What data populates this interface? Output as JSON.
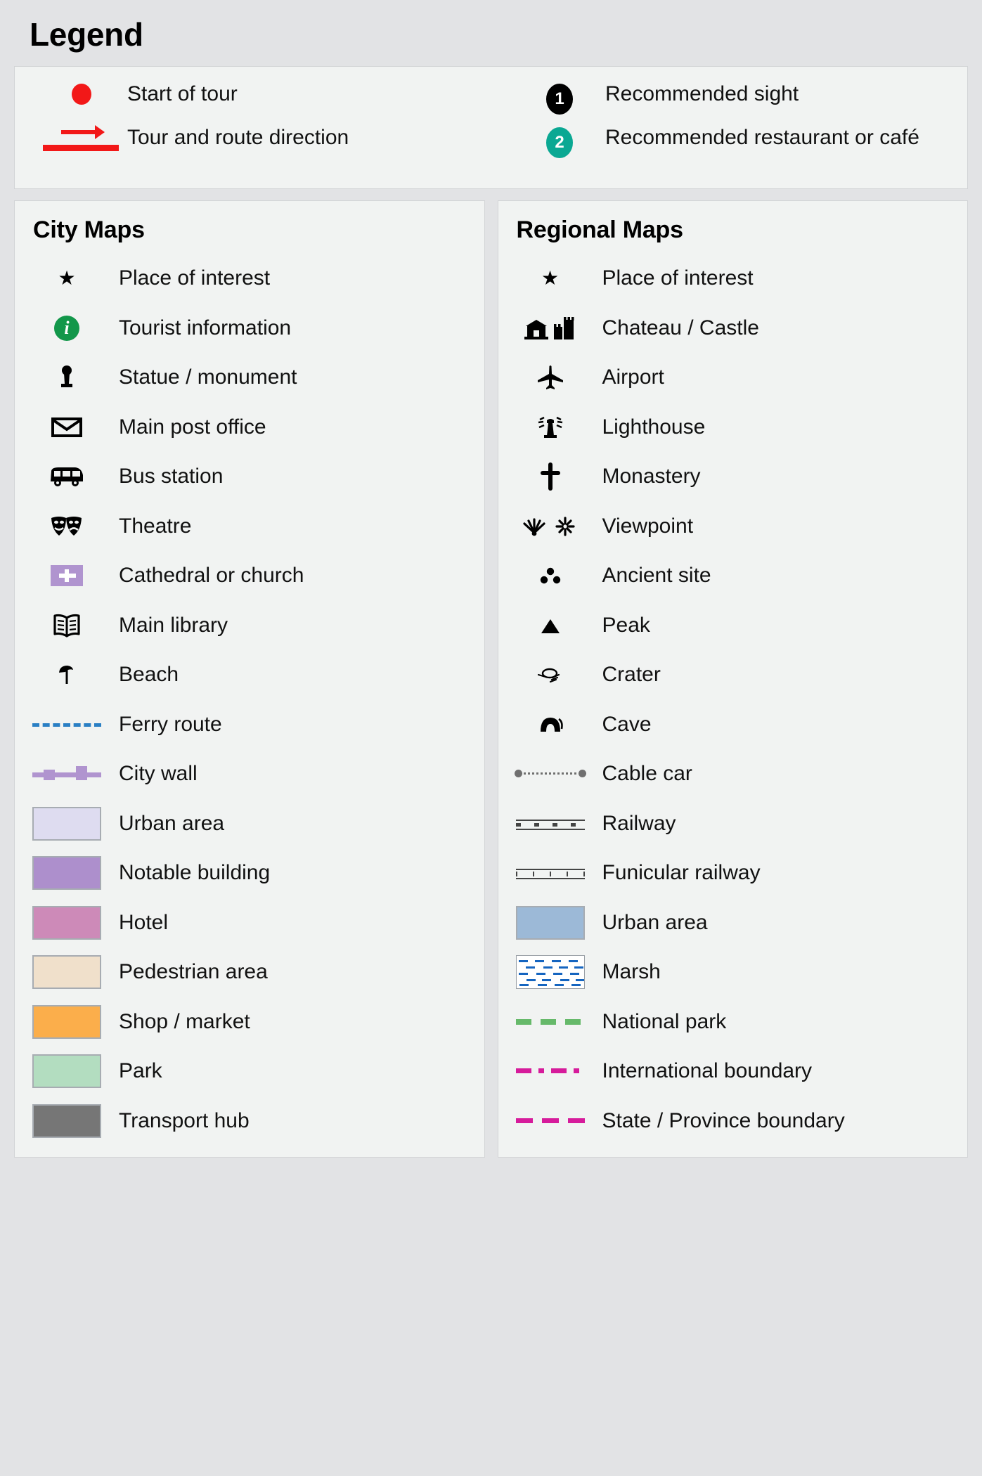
{
  "title": "Legend",
  "top": {
    "left_items": [
      {
        "label": "Start of tour",
        "symbol": "red-dot"
      },
      {
        "label": "Tour and route direction",
        "symbol": "red-arrow"
      }
    ],
    "right_items": [
      {
        "label": "Recommended sight",
        "symbol": "numbered-badge-black",
        "number": "1"
      },
      {
        "label": "Recommended restaurant or café",
        "symbol": "numbered-badge-teal",
        "number": "2"
      }
    ]
  },
  "city_maps": {
    "heading": "City Maps",
    "items": [
      {
        "label": "Place of interest",
        "symbol": "star-icon"
      },
      {
        "label": "Tourist information",
        "symbol": "information-icon"
      },
      {
        "label": "Statue / monument",
        "symbol": "statue-icon"
      },
      {
        "label": "Main post office",
        "symbol": "envelope-icon"
      },
      {
        "label": "Bus station",
        "symbol": "bus-icon"
      },
      {
        "label": "Theatre",
        "symbol": "theatre-masks-icon"
      },
      {
        "label": "Cathedral or church",
        "symbol": "church-chip-icon"
      },
      {
        "label": "Main library",
        "symbol": "open-book-icon"
      },
      {
        "label": "Beach",
        "symbol": "parasol-icon"
      },
      {
        "label": "Ferry route",
        "symbol": "ferry-dashed-line"
      },
      {
        "label": "City wall",
        "symbol": "city-wall-line"
      },
      {
        "label": "Urban area",
        "symbol": "area-swatch"
      },
      {
        "label": "Notable building",
        "symbol": "area-swatch"
      },
      {
        "label": "Hotel",
        "symbol": "area-swatch"
      },
      {
        "label": "Pedestrian area",
        "symbol": "area-swatch"
      },
      {
        "label": "Shop / market",
        "symbol": "area-swatch"
      },
      {
        "label": "Park",
        "symbol": "area-swatch"
      },
      {
        "label": "Transport hub",
        "symbol": "area-swatch"
      }
    ],
    "colors": {
      "urban_area": "#dedcf0",
      "notable_building": "#ad8fcc",
      "hotel": "#cd8ab8",
      "pedestrian_area": "#f0e0cb",
      "shop_market": "#fbae4b",
      "park": "#b3ddc0",
      "transport_hub": "#767676",
      "church_chip": "#b094cf",
      "city_wall": "#b094cf",
      "ferry_route": "#2a7fc4",
      "tourist_info": "#12974a"
    }
  },
  "regional_maps": {
    "heading": "Regional Maps",
    "items": [
      {
        "label": "Place of interest",
        "symbol": "star-icon"
      },
      {
        "label": "Chateau / Castle",
        "symbol": "chateau-castle-icons"
      },
      {
        "label": "Airport",
        "symbol": "airplane-icon"
      },
      {
        "label": "Lighthouse",
        "symbol": "lighthouse-icon"
      },
      {
        "label": "Monastery",
        "symbol": "cross-icon"
      },
      {
        "label": "Viewpoint",
        "symbol": "viewpoint-icons"
      },
      {
        "label": "Ancient site",
        "symbol": "three-dots-icon"
      },
      {
        "label": "Peak",
        "symbol": "triangle-icon"
      },
      {
        "label": "Crater",
        "symbol": "crater-icon"
      },
      {
        "label": "Cave",
        "symbol": "cave-icon"
      },
      {
        "label": "Cable car",
        "symbol": "cable-car-line"
      },
      {
        "label": "Railway",
        "symbol": "railway-line"
      },
      {
        "label": "Funicular railway",
        "symbol": "funicular-line"
      },
      {
        "label": "Urban area",
        "symbol": "area-swatch"
      },
      {
        "label": "Marsh",
        "symbol": "marsh-swatch"
      },
      {
        "label": "National park",
        "symbol": "green-dashed-line"
      },
      {
        "label": "International boundary",
        "symbol": "magenta-dashdot-line"
      },
      {
        "label": "State / Province boundary",
        "symbol": "magenta-dashed-line"
      }
    ],
    "colors": {
      "urban_area": "#9cb9d7",
      "marsh_fill": "#ffffff",
      "marsh_dash": "#1565c0",
      "national_park": "#66b96a",
      "international_boundary": "#d61b9b",
      "state_boundary": "#d61b9b",
      "cable_car": "#6f6f6f",
      "railway": "#444444"
    }
  }
}
